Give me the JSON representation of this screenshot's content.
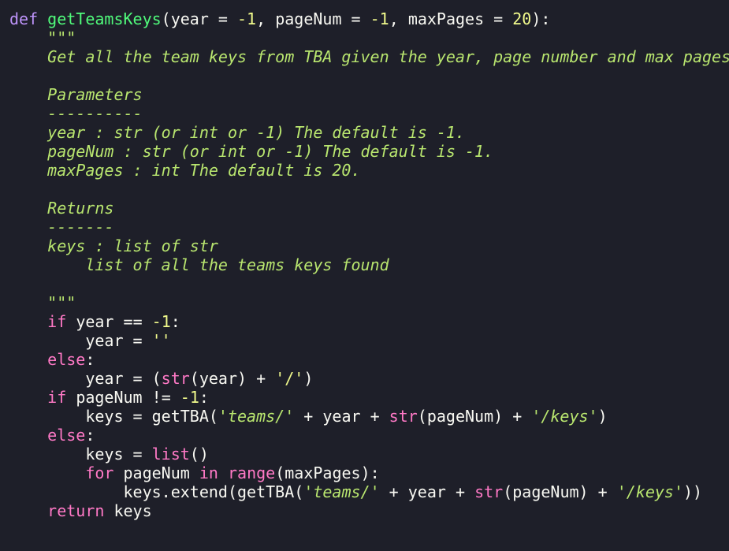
{
  "editor": {
    "language": "python",
    "colors": {
      "background": "#1e1f29",
      "keyword": "#ff79c6",
      "def_keyword": "#bd93f9",
      "function_name": "#50fa7b",
      "number": "#f1fa8c",
      "docstring": "#b9e66f",
      "text": "#f8f8f2"
    },
    "lines": [
      [
        [
          "kw-def",
          "def"
        ],
        [
          "ws",
          " "
        ],
        [
          "fn",
          "getTeamsKeys"
        ],
        [
          "op",
          "("
        ],
        [
          "id",
          "year"
        ],
        [
          "op",
          " = "
        ],
        [
          "num",
          "-1"
        ],
        [
          "op",
          ", "
        ],
        [
          "id",
          "pageNum"
        ],
        [
          "op",
          " = "
        ],
        [
          "num",
          "-1"
        ],
        [
          "op",
          ", "
        ],
        [
          "id",
          "maxPages"
        ],
        [
          "op",
          " = "
        ],
        [
          "num",
          "20"
        ],
        [
          "op",
          "):"
        ]
      ],
      [
        [
          "doc",
          "    \"\"\""
        ]
      ],
      [
        [
          "doc",
          "    Get all the team keys from TBA given the year, page number and max pages"
        ]
      ],
      [
        [
          "ws",
          ""
        ]
      ],
      [
        [
          "doc",
          "    Parameters"
        ]
      ],
      [
        [
          "doc",
          "    ----------"
        ]
      ],
      [
        [
          "doc",
          "    year : str (or int or -1) The default is -1."
        ]
      ],
      [
        [
          "doc",
          "    pageNum : str (or int or -1) The default is -1."
        ]
      ],
      [
        [
          "doc",
          "    maxPages : int The default is 20."
        ]
      ],
      [
        [
          "ws",
          ""
        ]
      ],
      [
        [
          "doc",
          "    Returns"
        ]
      ],
      [
        [
          "doc",
          "    -------"
        ]
      ],
      [
        [
          "doc",
          "    keys : list of str"
        ]
      ],
      [
        [
          "doc",
          "        list of all the teams keys found"
        ]
      ],
      [
        [
          "ws",
          ""
        ]
      ],
      [
        [
          "doc",
          "    \"\"\""
        ]
      ],
      [
        [
          "ws",
          "    "
        ],
        [
          "kw",
          "if"
        ],
        [
          "ws",
          " "
        ],
        [
          "id",
          "year"
        ],
        [
          "op",
          " == "
        ],
        [
          "num",
          "-1"
        ],
        [
          "op",
          ":"
        ]
      ],
      [
        [
          "ws",
          "        "
        ],
        [
          "id",
          "year"
        ],
        [
          "op",
          " = "
        ],
        [
          "str",
          "''"
        ]
      ],
      [
        [
          "ws",
          "    "
        ],
        [
          "kw",
          "else"
        ],
        [
          "op",
          ":"
        ]
      ],
      [
        [
          "ws",
          "        "
        ],
        [
          "id",
          "year"
        ],
        [
          "op",
          " = ("
        ],
        [
          "bi",
          "str"
        ],
        [
          "op",
          "("
        ],
        [
          "id",
          "year"
        ],
        [
          "op",
          ") + "
        ],
        [
          "str",
          "'/'"
        ],
        [
          "op",
          ")"
        ]
      ],
      [
        [
          "ws",
          "    "
        ],
        [
          "kw",
          "if"
        ],
        [
          "ws",
          " "
        ],
        [
          "id",
          "pageNum"
        ],
        [
          "op",
          " != "
        ],
        [
          "num",
          "-1"
        ],
        [
          "op",
          ":"
        ]
      ],
      [
        [
          "ws",
          "        "
        ],
        [
          "id",
          "keys"
        ],
        [
          "op",
          " = "
        ],
        [
          "id",
          "getTBA"
        ],
        [
          "op",
          "("
        ],
        [
          "str-it",
          "'teams/'"
        ],
        [
          "op",
          " + "
        ],
        [
          "id",
          "year"
        ],
        [
          "op",
          " + "
        ],
        [
          "bi",
          "str"
        ],
        [
          "op",
          "("
        ],
        [
          "id",
          "pageNum"
        ],
        [
          "op",
          ") + "
        ],
        [
          "str-it",
          "'/keys'"
        ],
        [
          "op",
          ")"
        ]
      ],
      [
        [
          "ws",
          "    "
        ],
        [
          "kw",
          "else"
        ],
        [
          "op",
          ":"
        ]
      ],
      [
        [
          "ws",
          "        "
        ],
        [
          "id",
          "keys"
        ],
        [
          "op",
          " = "
        ],
        [
          "bi",
          "list"
        ],
        [
          "op",
          "()"
        ]
      ],
      [
        [
          "ws",
          "        "
        ],
        [
          "kw",
          "for"
        ],
        [
          "ws",
          " "
        ],
        [
          "id",
          "pageNum"
        ],
        [
          "ws",
          " "
        ],
        [
          "kw",
          "in"
        ],
        [
          "ws",
          " "
        ],
        [
          "bi",
          "range"
        ],
        [
          "op",
          "("
        ],
        [
          "id",
          "maxPages"
        ],
        [
          "op",
          "):"
        ]
      ],
      [
        [
          "ws",
          "            "
        ],
        [
          "id",
          "keys"
        ],
        [
          "op",
          "."
        ],
        [
          "id",
          "extend"
        ],
        [
          "op",
          "("
        ],
        [
          "id",
          "getTBA"
        ],
        [
          "op",
          "("
        ],
        [
          "str-it",
          "'teams/'"
        ],
        [
          "op",
          " + "
        ],
        [
          "id",
          "year"
        ],
        [
          "op",
          " + "
        ],
        [
          "bi",
          "str"
        ],
        [
          "op",
          "("
        ],
        [
          "id",
          "pageNum"
        ],
        [
          "op",
          ") + "
        ],
        [
          "str-it",
          "'/keys'"
        ],
        [
          "op",
          "))"
        ]
      ],
      [
        [
          "ws",
          "    "
        ],
        [
          "kw",
          "return"
        ],
        [
          "ws",
          " "
        ],
        [
          "id",
          "keys"
        ]
      ]
    ]
  }
}
